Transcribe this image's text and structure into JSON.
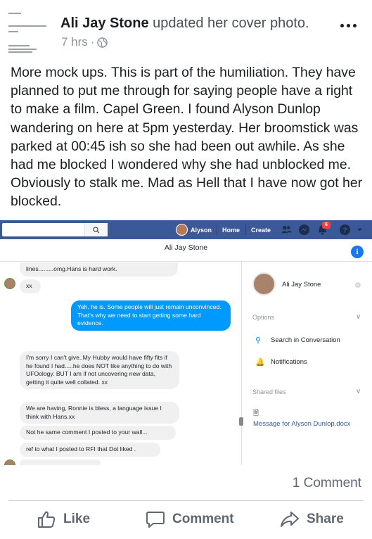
{
  "post": {
    "author": "Ali Jay Stone",
    "action": " updated her cover photo.",
    "time": "7 hrs",
    "dot": "·",
    "text": "More mock ups. This is part of the humiliation. They have planned to put me through for saying people have a right to make a film. Capel Green. I found Alyson Dunlop wandering on here at 5pm yesterday. Her broomstick was parked at 00:45 ish so she had been out awhile. As she had me blocked I wondered why she had unblocked me. Obviously to stalk me. Mad as Hell that I have now got her blocked.",
    "comment_count": "1 Comment"
  },
  "screenshot": {
    "topbar": {
      "user": "Alyson",
      "home": "Home",
      "create": "Create",
      "badge": "6"
    },
    "chat_title": "Ali Jay Stone",
    "messages": [
      {
        "text": "lines.........omg.Hans is hard work."
      },
      {
        "text": "xx"
      },
      {
        "text": "Yeh, he is.  Some people will just remain unconvinced.  That's why we need to start getting some hard evidence."
      },
      {
        "text": "I'm sorry I can't give..My Hubby would have fifty fits if he found I had.....he does NOT like anything to do with UFOology. BUT I am if not uncovering new data, getting it quite well collated. xx"
      },
      {
        "text": "We are having, Ronnie is bless, a language issue I think with Hans.xx"
      },
      {
        "text": "Not he same comment I posted to your wall..."
      },
      {
        "text": "ref to what I posted to RFI that Dot liked ."
      }
    ],
    "side": {
      "name": "Ali Jay Stone",
      "options": "Options",
      "search": "Search in Conversation",
      "notifications": "Notifications",
      "shared_files": "Shared files",
      "file": "Message for Alyson Dunlop.docx"
    }
  },
  "actions": {
    "like": "Like",
    "comment": "Comment",
    "share": "Share"
  },
  "colors": {
    "facebook_blue": "#3b5998",
    "messenger_blue": "#0099ff",
    "link": "#365899"
  }
}
